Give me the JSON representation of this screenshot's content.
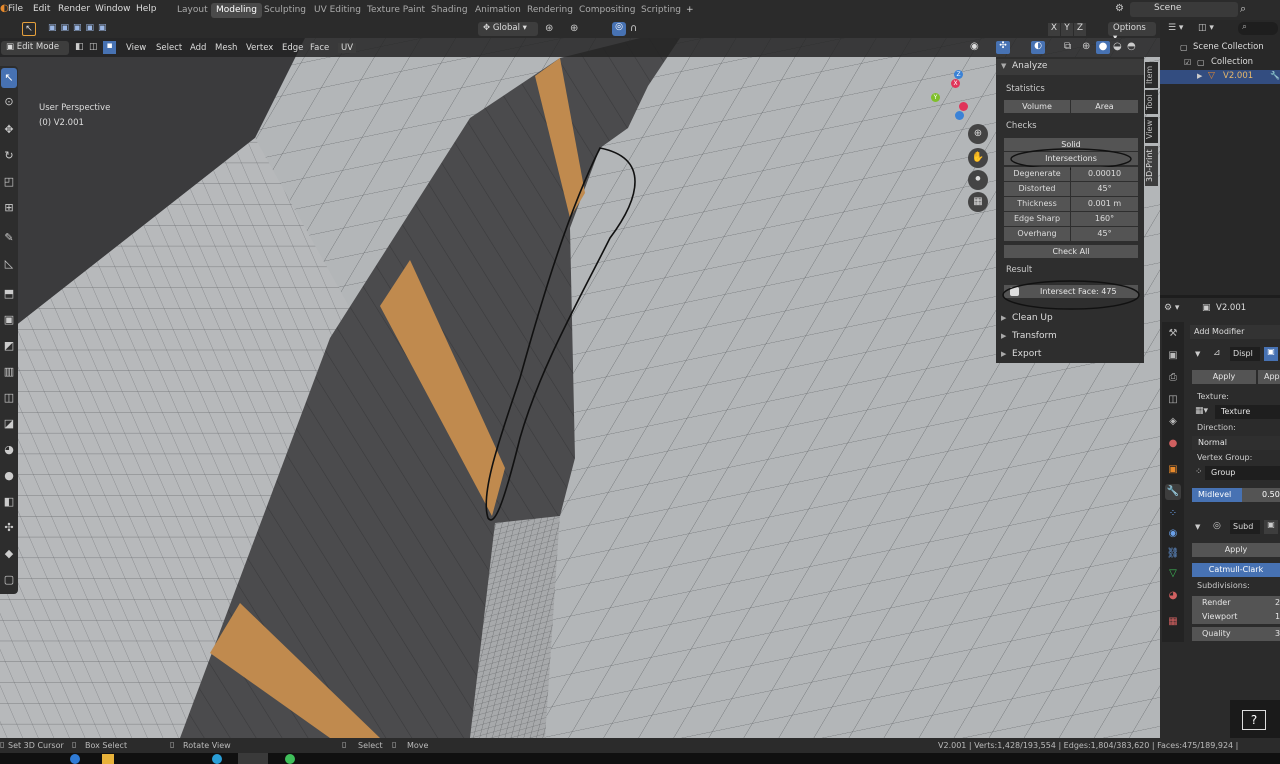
{
  "top_menu": [
    "File",
    "Edit",
    "Render",
    "Window",
    "Help"
  ],
  "workspaces": [
    {
      "label": "Layout",
      "active": false
    },
    {
      "label": "Modeling",
      "active": true
    },
    {
      "label": "Sculpting",
      "active": false
    },
    {
      "label": "UV Editing",
      "active": false
    },
    {
      "label": "Texture Paint",
      "active": false
    },
    {
      "label": "Shading",
      "active": false
    },
    {
      "label": "Animation",
      "active": false
    },
    {
      "label": "Rendering",
      "active": false
    },
    {
      "label": "Compositing",
      "active": false
    },
    {
      "label": "Scripting",
      "active": false
    }
  ],
  "add_workspace": "+",
  "scene_name": "Scene",
  "header": {
    "mode": "Edit Mode",
    "menus": [
      "View",
      "Select",
      "Add",
      "Mesh",
      "Vertex",
      "Edge",
      "Face",
      "UV"
    ],
    "orientation": "Global",
    "axes": [
      "X",
      "Y",
      "Z"
    ],
    "options": "Options"
  },
  "viewport": {
    "perspective": "User Perspective",
    "object": "(0) V2.001",
    "gizmo": {
      "x": "X",
      "y": "Y",
      "z": "Z"
    }
  },
  "npanel": {
    "title": "Analyze",
    "statistics_label": "Statistics",
    "volume": "Volume",
    "area": "Area",
    "checks_label": "Checks",
    "solid": "Solid",
    "intersections": "Intersections",
    "checks": [
      {
        "label": "Degenerate",
        "value": "0.00010"
      },
      {
        "label": "Distorted",
        "value": "45°"
      },
      {
        "label": "Thickness",
        "value": "0.001 m"
      },
      {
        "label": "Edge Sharp",
        "value": "160°"
      },
      {
        "label": "Overhang",
        "value": "45°"
      }
    ],
    "check_all": "Check All",
    "result_label": "Result",
    "result_value": "Intersect Face: 475",
    "sections": [
      "Clean Up",
      "Transform",
      "Export"
    ]
  },
  "side_tabs": [
    "Item",
    "Tool",
    "View",
    "3D-Print"
  ],
  "outliner": {
    "scene_collection": "Scene Collection",
    "collection": "Collection",
    "object": "V2.001"
  },
  "properties": {
    "object": "V2.001",
    "add_modifier": "Add Modifier",
    "mod1_name": "Displ",
    "apply": "Apply",
    "apply2": "Appl",
    "texture_label": "Texture:",
    "texture_value": "Texture",
    "direction_label": "Direction:",
    "direction_value": "Normal",
    "vgroup_label": "Vertex Group:",
    "vgroup_value": "Group",
    "midlevel_label": "Midlevel",
    "midlevel_value": "0.50",
    "mod2_name": "Subd",
    "mod2_apply": "Apply",
    "catmull": "Catmull-Clark",
    "subdiv_label": "Subdivisions:",
    "render_label": "Render",
    "render_value": "2",
    "viewport_label": "Viewport",
    "viewport_value": "1",
    "quality_label": "Quality",
    "quality_value": "3"
  },
  "status": {
    "left": [
      "Set 3D Cursor",
      "Box Select",
      "Rotate View"
    ],
    "middle": [
      "Select",
      "Move"
    ],
    "right": "V2.001 | Verts:1,428/193,554 | Edges:1,804/383,620 | Faces:475/189,924 |"
  },
  "help": "?",
  "colors": {
    "accent": "#4772b3",
    "orange": "#c08a4e",
    "wall": "#4a4a4c",
    "ground": "#b5b8ba"
  }
}
